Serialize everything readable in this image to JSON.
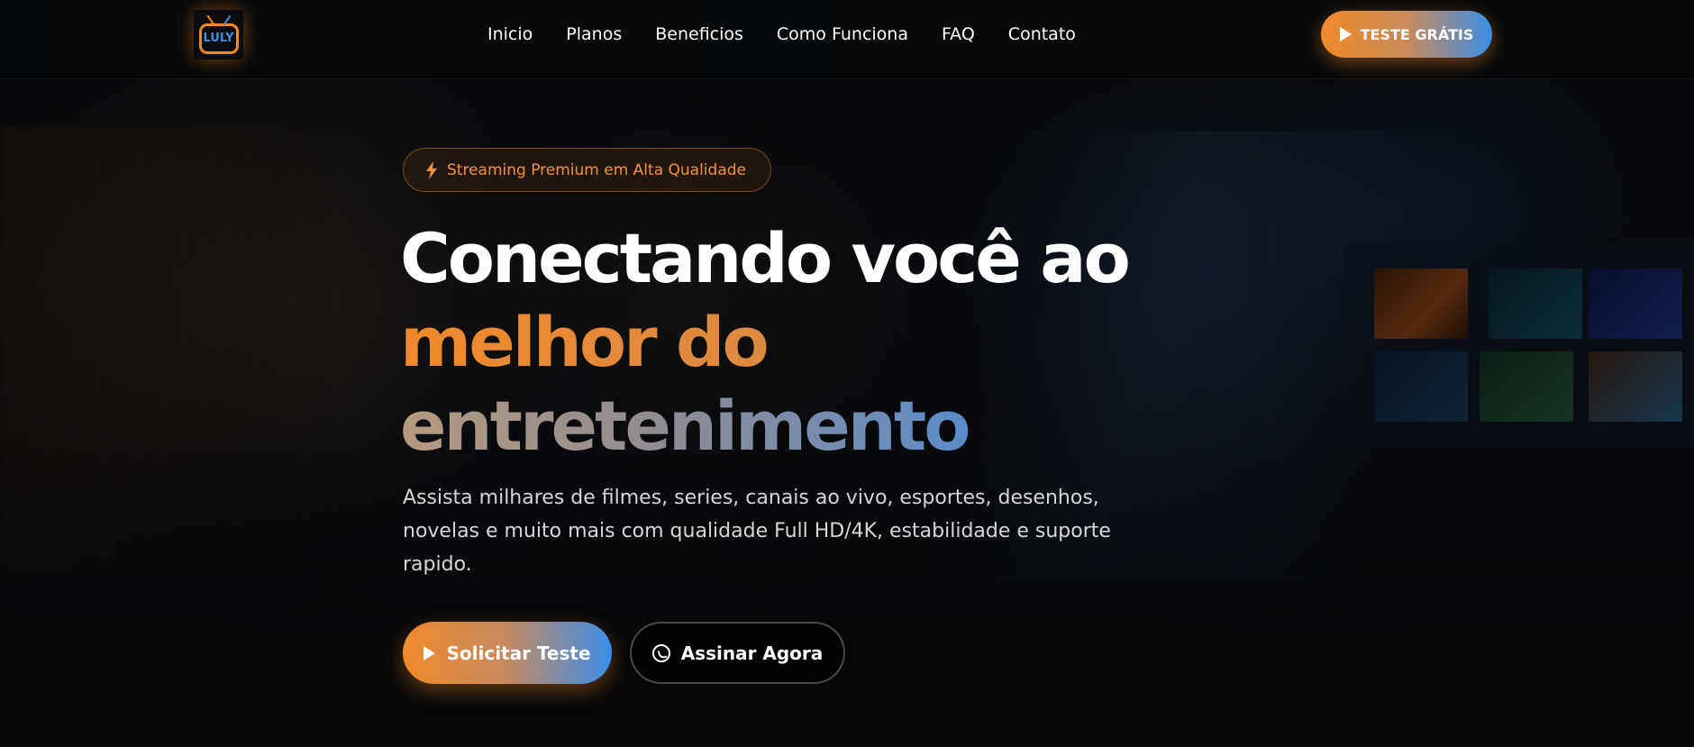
{
  "brand": {
    "logo_text": "LULY"
  },
  "nav": {
    "items": [
      {
        "label": "Inicio"
      },
      {
        "label": "Planos"
      },
      {
        "label": "Beneficios"
      },
      {
        "label": "Como Funciona"
      },
      {
        "label": "FAQ"
      },
      {
        "label": "Contato"
      }
    ]
  },
  "header_cta": {
    "label": "TESTE GRÁTIS",
    "icon": "play-icon"
  },
  "hero": {
    "badge": {
      "icon": "bolt-icon",
      "label": "Streaming Premium em Alta Qualidade"
    },
    "title": {
      "line1": "Conectando você ao",
      "line2": "melhor do",
      "line3": "entretenimento"
    },
    "description": "Assista milhares de filmes, series, canais ao vivo, esportes, desenhos, novelas e muito mais com qualidade Full HD/4K, estabilidade e suporte rapido.",
    "primary_button": {
      "label": "Solicitar Teste",
      "icon": "play-icon"
    },
    "secondary_button": {
      "label": "Assinar Agora",
      "icon": "whatsapp-icon"
    }
  },
  "colors": {
    "accent_orange": "#f0892a",
    "accent_blue": "#2f8af0",
    "background": "#050608",
    "badge_text": "#f2913a"
  }
}
